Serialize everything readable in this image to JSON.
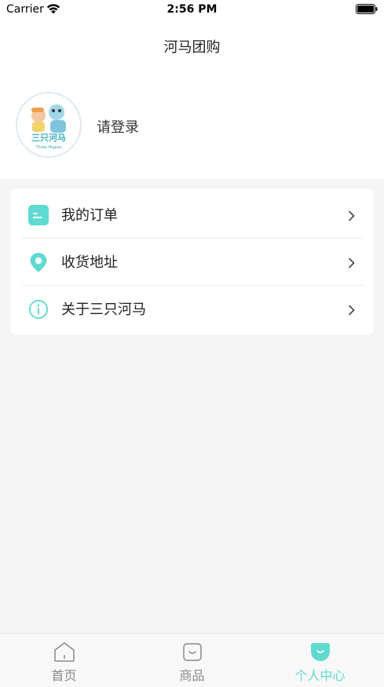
{
  "status_bar": {
    "carrier": "Carrier",
    "time": "2:56 PM"
  },
  "nav": {
    "title": "河马团购"
  },
  "profile": {
    "login_label": "请登录",
    "avatar_logo_text": "三只河马",
    "avatar_logo_subtext": "Three Hippos"
  },
  "menu": [
    {
      "label": "我的订单",
      "icon": "order-list-icon"
    },
    {
      "label": "收货地址",
      "icon": "location-pin-icon"
    },
    {
      "label": "关于三只河马",
      "icon": "info-icon"
    }
  ],
  "tabs": [
    {
      "label": "首页",
      "icon": "home-icon",
      "active": false
    },
    {
      "label": "商品",
      "icon": "bag-icon",
      "active": false
    },
    {
      "label": "个人中心",
      "icon": "profile-face-icon",
      "active": true
    }
  ],
  "colors": {
    "accent": "#5fdad1",
    "background": "#f5f5f5",
    "card": "#ffffff",
    "text": "#222222",
    "inactive_tab": "#888888"
  }
}
